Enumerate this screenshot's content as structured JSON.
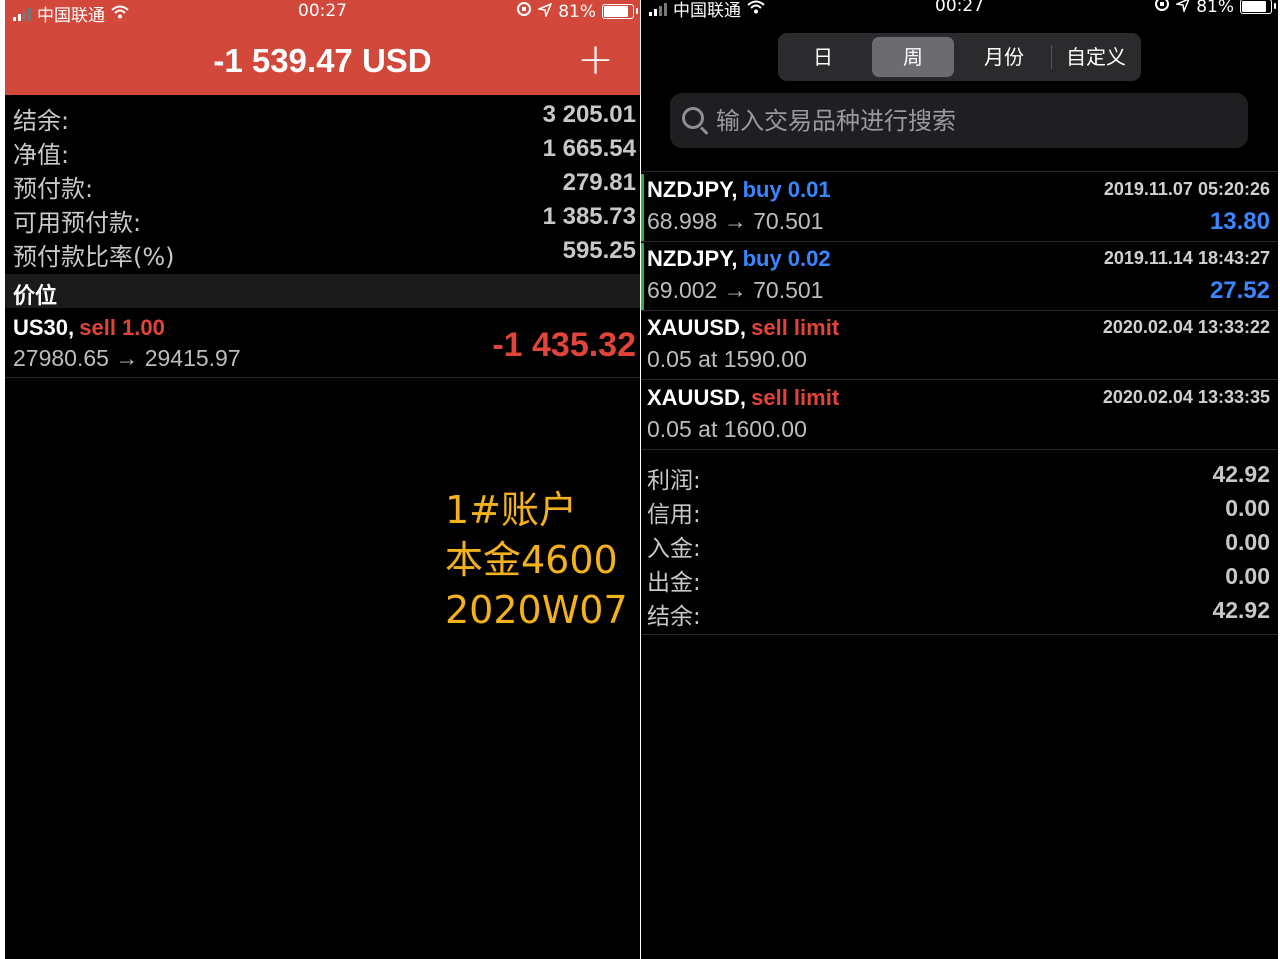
{
  "left": {
    "status": {
      "carrier": "中国联通",
      "time": "00:27",
      "battery": "81%"
    },
    "header": {
      "title": "-1 539.47 USD",
      "add_label": "+"
    },
    "summary": [
      {
        "label": "结余:",
        "value": "3 205.01"
      },
      {
        "label": "净值:",
        "value": "1 665.54"
      },
      {
        "label": "预付款:",
        "value": "279.81"
      },
      {
        "label": "可用预付款:",
        "value": "1 385.73"
      },
      {
        "label": "预付款比率(%)",
        "value": "595.25"
      }
    ],
    "positions_header": "价位",
    "position": {
      "symbol": "US30,",
      "side": "sell 1.00",
      "prices": "27980.65 → 29415.97",
      "profit": "-1 435.32"
    },
    "note": [
      "1#账户",
      "本金4600",
      "2020W07"
    ]
  },
  "right": {
    "status": {
      "carrier": "中国联通",
      "time": "00:27",
      "battery": "81%"
    },
    "tabs": [
      "日",
      "周",
      "月份",
      "自定义"
    ],
    "active_tab": "周",
    "search": {
      "placeholder": "输入交易品种进行搜索",
      "value": ""
    },
    "orders": [
      {
        "symbol": "NZDJPY,",
        "side": "buy 0.01",
        "side_color": "#3a86ff",
        "time": "2019.11.07 05:20:26",
        "detail": "68.998 → 70.501",
        "profit": "13.80",
        "bar": true
      },
      {
        "symbol": "NZDJPY,",
        "side": "buy 0.02",
        "side_color": "#3a86ff",
        "time": "2019.11.14 18:43:27",
        "detail": "69.002 → 70.501",
        "profit": "27.52",
        "bar": true
      },
      {
        "symbol": "XAUUSD,",
        "side": "sell limit",
        "side_color": "#e0443a",
        "time": "2020.02.04 13:33:22",
        "detail": "0.05 at 1590.00",
        "profit": "",
        "bar": false
      },
      {
        "symbol": "XAUUSD,",
        "side": "sell limit",
        "side_color": "#e0443a",
        "time": "2020.02.04 13:33:35",
        "detail": "0.05 at 1600.00",
        "profit": "",
        "bar": false
      }
    ],
    "totals": [
      {
        "label": "利润:",
        "value": "42.92"
      },
      {
        "label": "信用:",
        "value": "0.00"
      },
      {
        "label": "入金:",
        "value": "0.00"
      },
      {
        "label": "出金:",
        "value": "0.00"
      },
      {
        "label": "结余:",
        "value": "42.92"
      }
    ]
  },
  "colors": {
    "header_red": "#d2483a",
    "loss_red": "#e0443a",
    "buy_blue": "#3a86ff",
    "note_gold": "#f3b21b",
    "active_bar_green": "#2fb14a"
  }
}
